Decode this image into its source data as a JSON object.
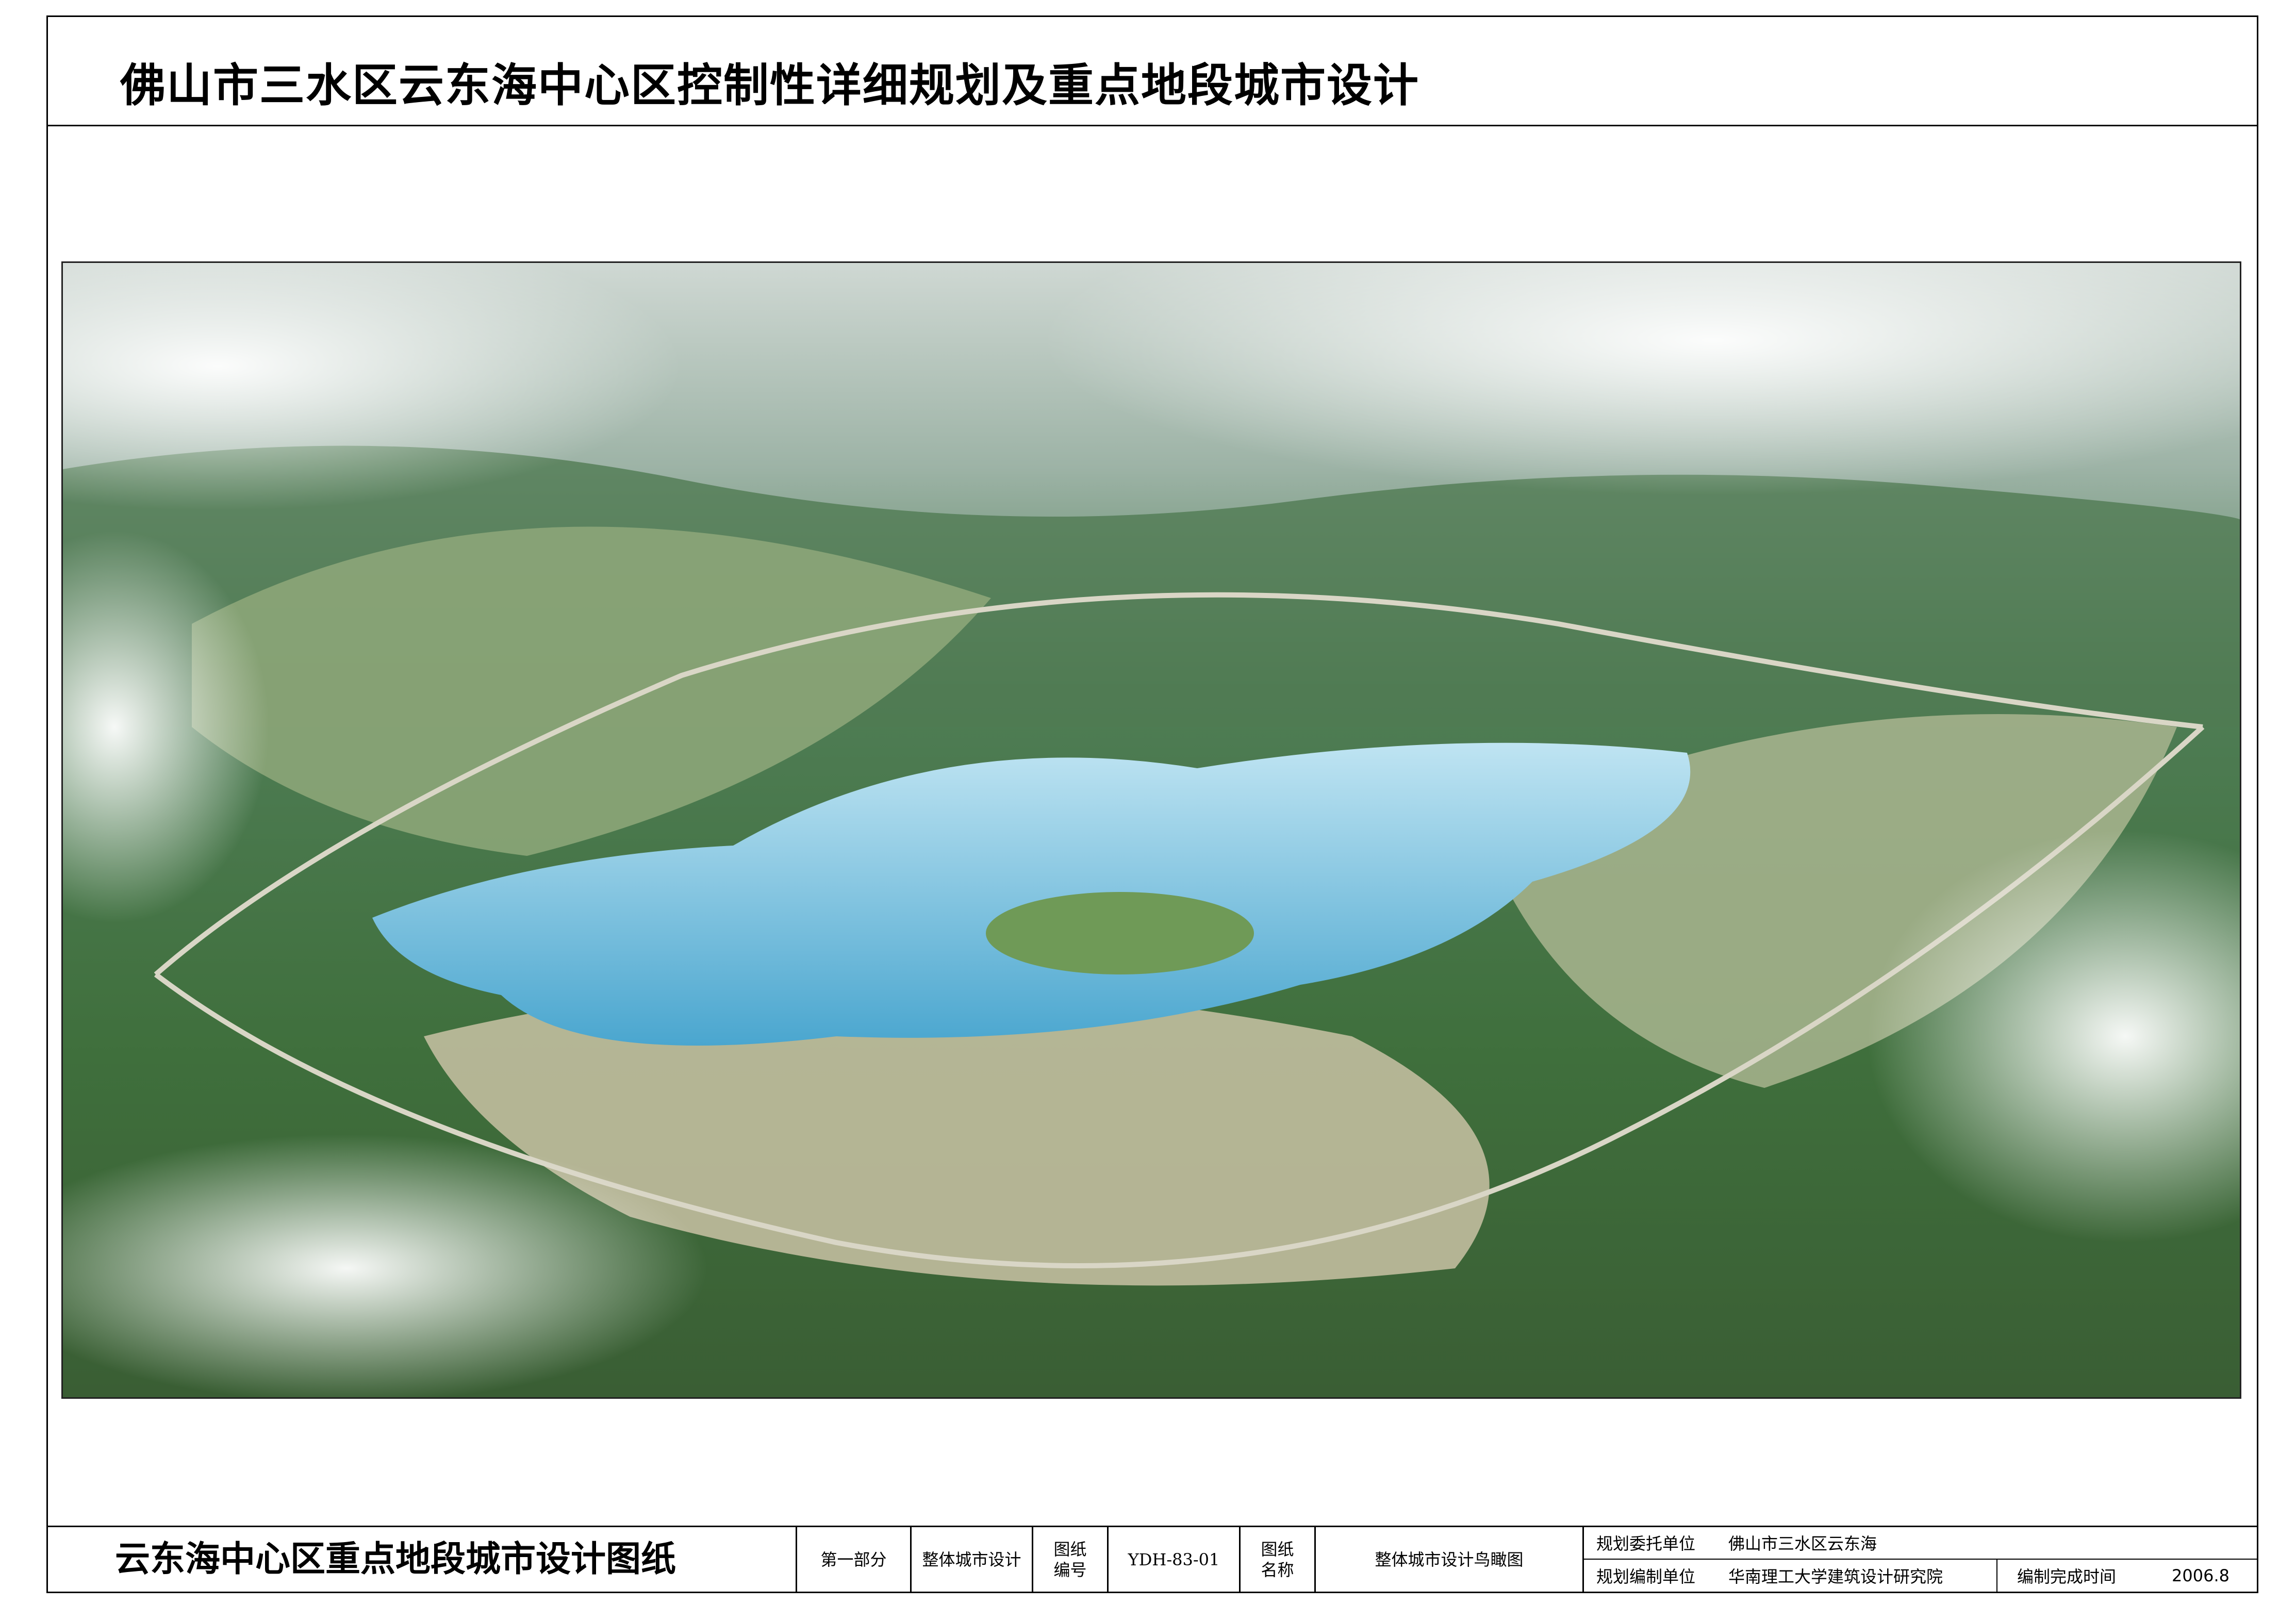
{
  "header": {
    "title": "佛山市三水区云东海中心区控制性详细规划及重点地段城市设计"
  },
  "image": {
    "description_icon": "aerial-rendering-image"
  },
  "footer": {
    "drawing_set_title": "云东海中心区重点地段城市设计图纸",
    "part_label": "第一部分",
    "section_name": "整体城市设计",
    "drawing_number_label": "图纸\n编号",
    "drawing_number_label_l1": "图纸",
    "drawing_number_label_l2": "编号",
    "drawing_number": "YDH-83-01",
    "drawing_name_label_l1": "图纸",
    "drawing_name_label_l2": "名称",
    "drawing_name": "整体城市设计鸟瞰图",
    "client_label": "规划委托单位",
    "client_value": "佛山市三水区云东海",
    "designer_label": "规划编制单位",
    "designer_value": "华南理工大学建筑设计研究院",
    "completion_label": "编制完成时间",
    "completion_value": "2006.8"
  }
}
